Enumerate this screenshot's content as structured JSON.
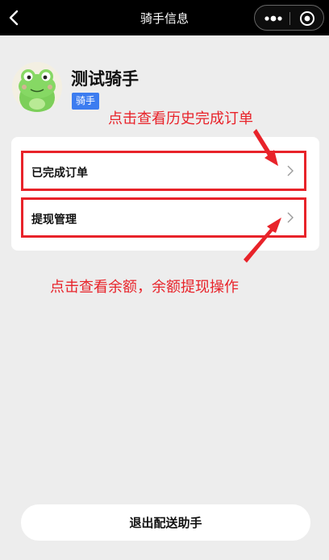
{
  "nav": {
    "title": "骑手信息"
  },
  "profile": {
    "name": "测试骑手",
    "role_badge": "骑手"
  },
  "menu": {
    "items": [
      {
        "label": "已完成订单"
      },
      {
        "label": "提现管理"
      }
    ]
  },
  "annotations": {
    "history_hint": "点击查看历史完成订单",
    "balance_hint": "点击查看余额，余额提现操作",
    "color": "#e8232a"
  },
  "footer": {
    "logout_label": "退出配送助手"
  },
  "colors": {
    "badge": "#3c7cf0",
    "background": "#ededed",
    "nav": "#000000"
  }
}
